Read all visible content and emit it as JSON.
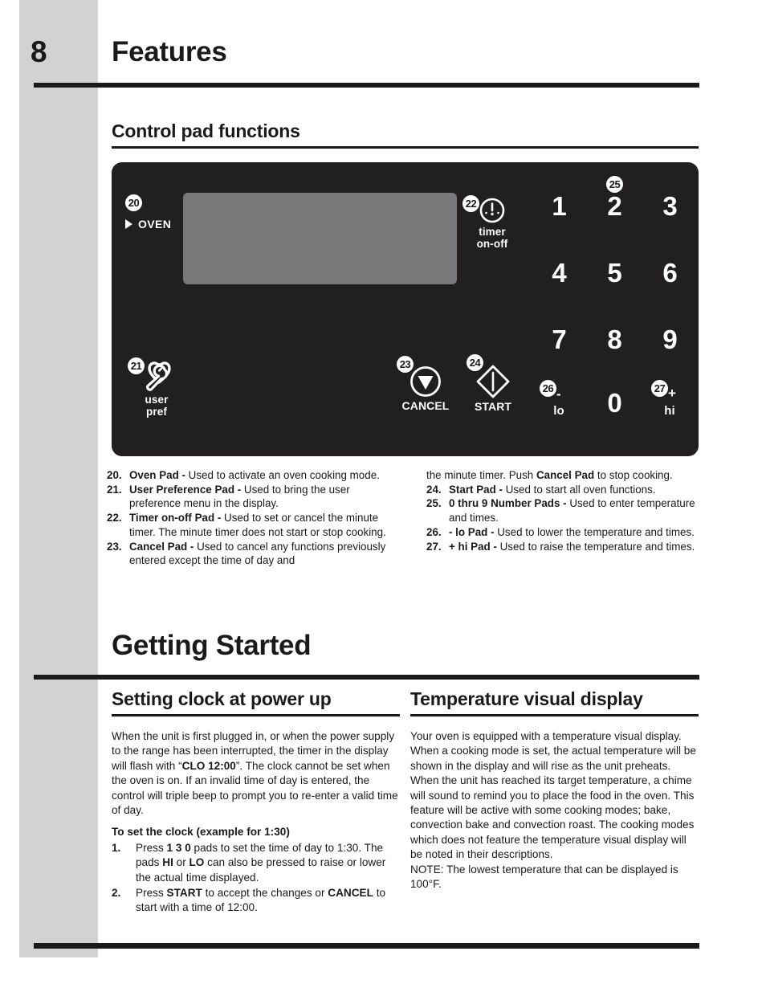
{
  "page": {
    "number": "8",
    "chapter_title": "Features",
    "section_title": "Control pad functions",
    "chapter_title_2": "Getting Started"
  },
  "colors": {
    "panel_bg": "#211f1f",
    "display_bg": "#78787a",
    "band_gray": "#d2d2d2",
    "ink": "#1a1a1a",
    "pad_text": "#ffffff"
  },
  "control_panel": {
    "oven": {
      "badge": "20",
      "label": "OVEN",
      "indicator_icon": "triangle-right-icon"
    },
    "user_pref": {
      "badge": "21",
      "label_line1": "user",
      "label_line2": "pref",
      "icon": "wrench-heart-icon"
    },
    "timer": {
      "badge": "22",
      "label_line1": "timer",
      "label_line2": "on-off",
      "icon": "timer-clock-icon"
    },
    "cancel": {
      "badge": "23",
      "label": "CANCEL",
      "icon": "triangle-down-circle-icon"
    },
    "start": {
      "badge": "24",
      "label": "START",
      "icon": "diamond-bar-icon"
    },
    "numbers": {
      "badge": "25",
      "keys": [
        "1",
        "2",
        "3",
        "4",
        "5",
        "6",
        "7",
        "8",
        "9",
        "0"
      ]
    },
    "lo": {
      "badge": "26",
      "sign": "-",
      "label": "lo"
    },
    "hi": {
      "badge": "27",
      "sign": "+",
      "label": "hi"
    }
  },
  "callouts": {
    "left": [
      {
        "num": "20.",
        "bold": "Oven Pad - ",
        "rest": "Used to activate an oven cooking mode."
      },
      {
        "num": "21.",
        "bold": "User Preference Pad - ",
        "rest": "Used to bring the user preference menu in the display."
      },
      {
        "num": "22.",
        "bold": "Timer on-off Pad - ",
        "rest": "Used to set or cancel the minute timer. The minute timer does not start or stop cooking."
      },
      {
        "num": "23.",
        "bold": "Cancel Pad - ",
        "rest": "Used to cancel any functions previously entered except the time of day and"
      }
    ],
    "right_continuation_pre": "the minute timer. Push ",
    "right_continuation_bold": "Cancel Pad",
    "right_continuation_post": " to stop cooking.",
    "right": [
      {
        "num": "24.",
        "bold": "Start Pad - ",
        "rest": "Used to start all oven functions."
      },
      {
        "num": "25.",
        "bold": "0 thru 9 Number Pads - ",
        "rest": "Used to enter temperature and times."
      },
      {
        "num": "26.",
        "bold": "- lo Pad - ",
        "rest": "Used to lower the temperature and times."
      },
      {
        "num": "27.",
        "bold": "+ hi Pad - ",
        "rest": "Used to raise the temperature and times."
      }
    ]
  },
  "getting_started": {
    "left": {
      "heading": "Setting clock at power up",
      "para_1a": "When the unit is first plugged in, or when the power supply to the range has been interrupted, the timer in the display will flash with “",
      "para_1_bold": "CLO 12:00",
      "para_1b": "”. The clock cannot be set when the oven is on. If an invalid time of day is entered, the control will triple beep to prompt you to re-enter a valid time of day.",
      "sub_heading": "To set the clock (example for 1:30)",
      "steps": [
        {
          "num": "1.",
          "pre": "Press ",
          "b1": "1 3 0",
          "mid1": " pads to set the time of day to 1:30. The pads ",
          "b2": "HI",
          "mid2": " or ",
          "b3": "LO",
          "post": " can also be pressed to raise or lower the actual time displayed."
        },
        {
          "num": "2.",
          "pre": "Press ",
          "b1": "START",
          "mid1": " to accept the changes or ",
          "b2": "CANCEL",
          "mid2": "",
          "b3": "",
          "post": " to start with a time of 12:00."
        }
      ]
    },
    "right": {
      "heading": "Temperature visual display",
      "para_1": "Your oven is equipped with a temperature visual display. When a cooking mode is set, the actual temperature will be shown in the display and will rise as the unit preheats. When the unit has reached its target temperature, a chime will sound to remind you to place the food in the oven. This feature will be active with some cooking modes; bake, convection bake and  convection roast. The cooking modes which does not feature the temperature visual display will be noted in their descriptions.",
      "para_2": "NOTE: The lowest temperature that can be displayed is 100°F."
    }
  }
}
